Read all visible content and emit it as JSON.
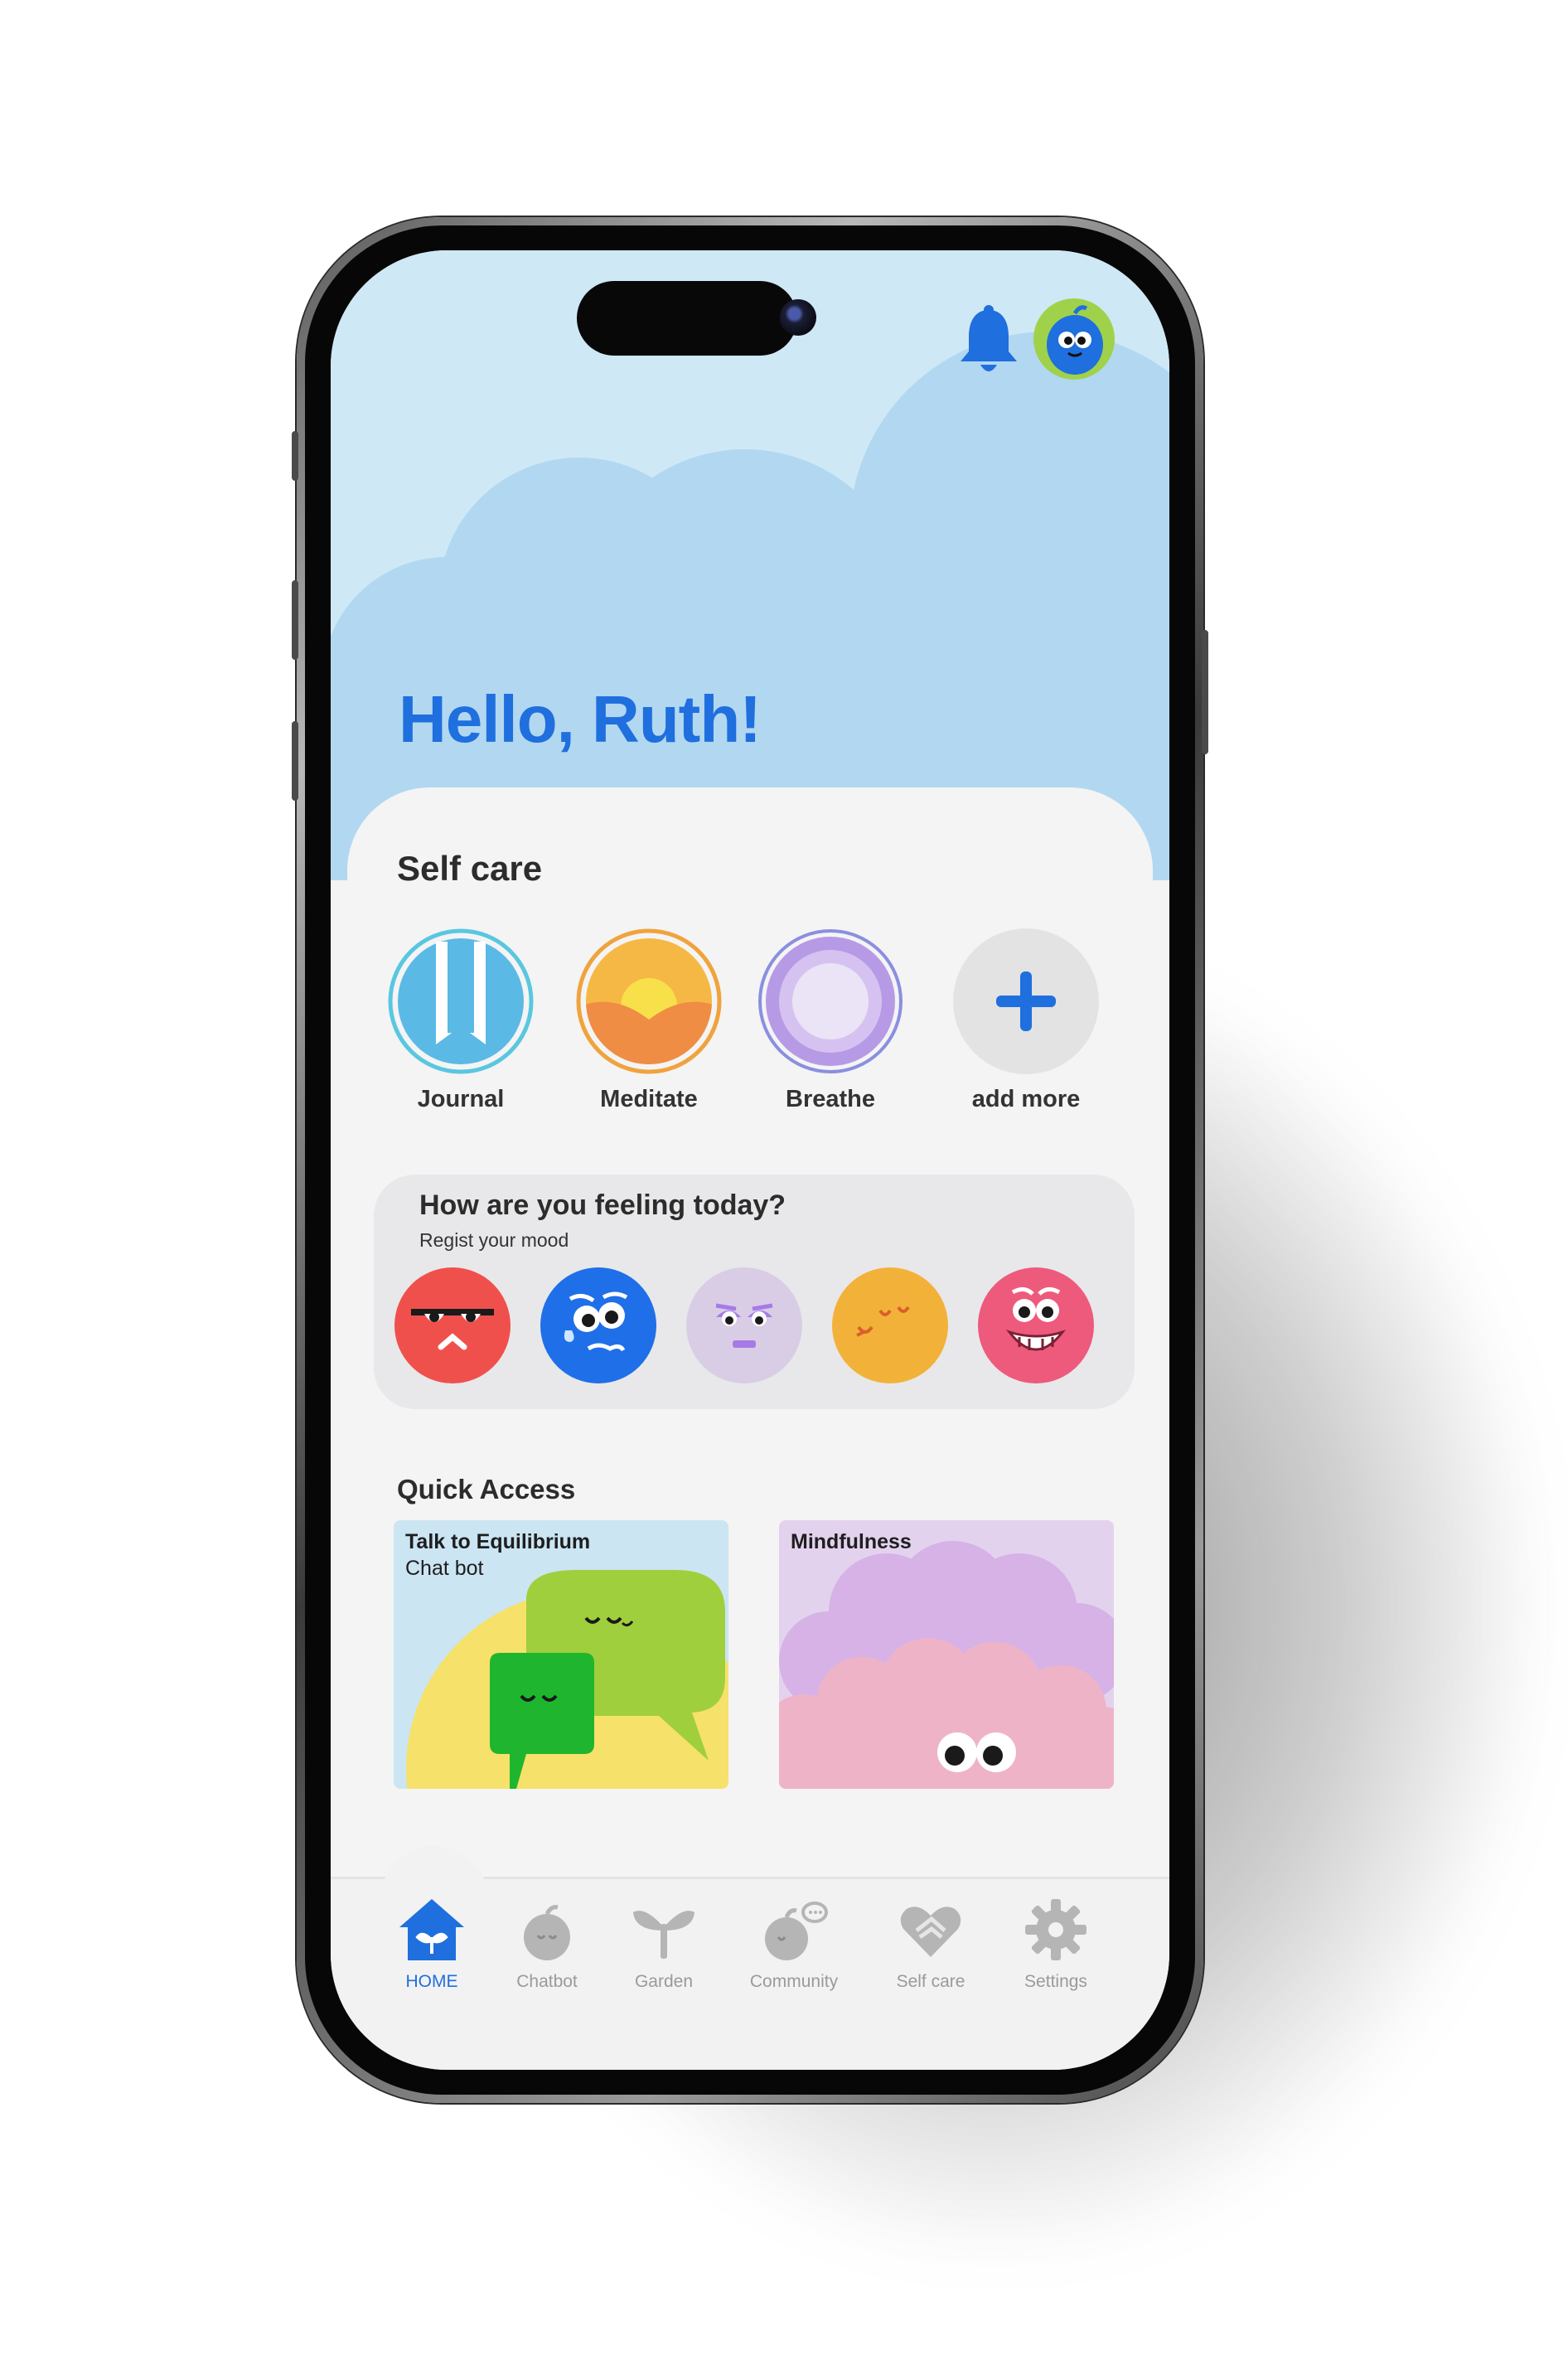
{
  "header": {
    "greeting": "Hello, Ruth!",
    "notification_icon": "bell-icon",
    "avatar_icon": "blue-monster-avatar"
  },
  "self_care": {
    "title": "Self care",
    "items": [
      {
        "label": "Journal",
        "icon": "bookmark-icon"
      },
      {
        "label": "Meditate",
        "icon": "sunrise-icon"
      },
      {
        "label": "Breathe",
        "icon": "breathe-rings-icon"
      },
      {
        "label": "add more",
        "icon": "plus-icon"
      }
    ]
  },
  "mood": {
    "question": "How are you feeling today?",
    "subtitle": "Regist your mood",
    "options": [
      {
        "name": "angry",
        "color": "#f0504c"
      },
      {
        "name": "sad",
        "color": "#1f6fe8"
      },
      {
        "name": "meh",
        "color": "#d9cde6"
      },
      {
        "name": "calm",
        "color": "#f2b23a"
      },
      {
        "name": "happy",
        "color": "#ee5a7c"
      }
    ]
  },
  "quick_access": {
    "title": "Quick Access",
    "cards": [
      {
        "title": "Talk to Equilibrium",
        "subtitle": "Chat bot"
      },
      {
        "title": "Mindfulness",
        "subtitle": ""
      }
    ]
  },
  "nav": {
    "items": [
      {
        "label": "HOME",
        "icon": "home-icon",
        "active": true
      },
      {
        "label": "Chatbot",
        "icon": "chatbot-icon",
        "active": false
      },
      {
        "label": "Garden",
        "icon": "sprout-icon",
        "active": false
      },
      {
        "label": "Community",
        "icon": "community-icon",
        "active": false
      },
      {
        "label": "Self care",
        "icon": "heart-hands-icon",
        "active": false
      },
      {
        "label": "Settings",
        "icon": "gear-icon",
        "active": false
      }
    ]
  },
  "colors": {
    "accent": "#1f6fde",
    "sky": "#cfe8f5",
    "cloud": "#b2d7f1",
    "background": "#f4f4f4"
  }
}
